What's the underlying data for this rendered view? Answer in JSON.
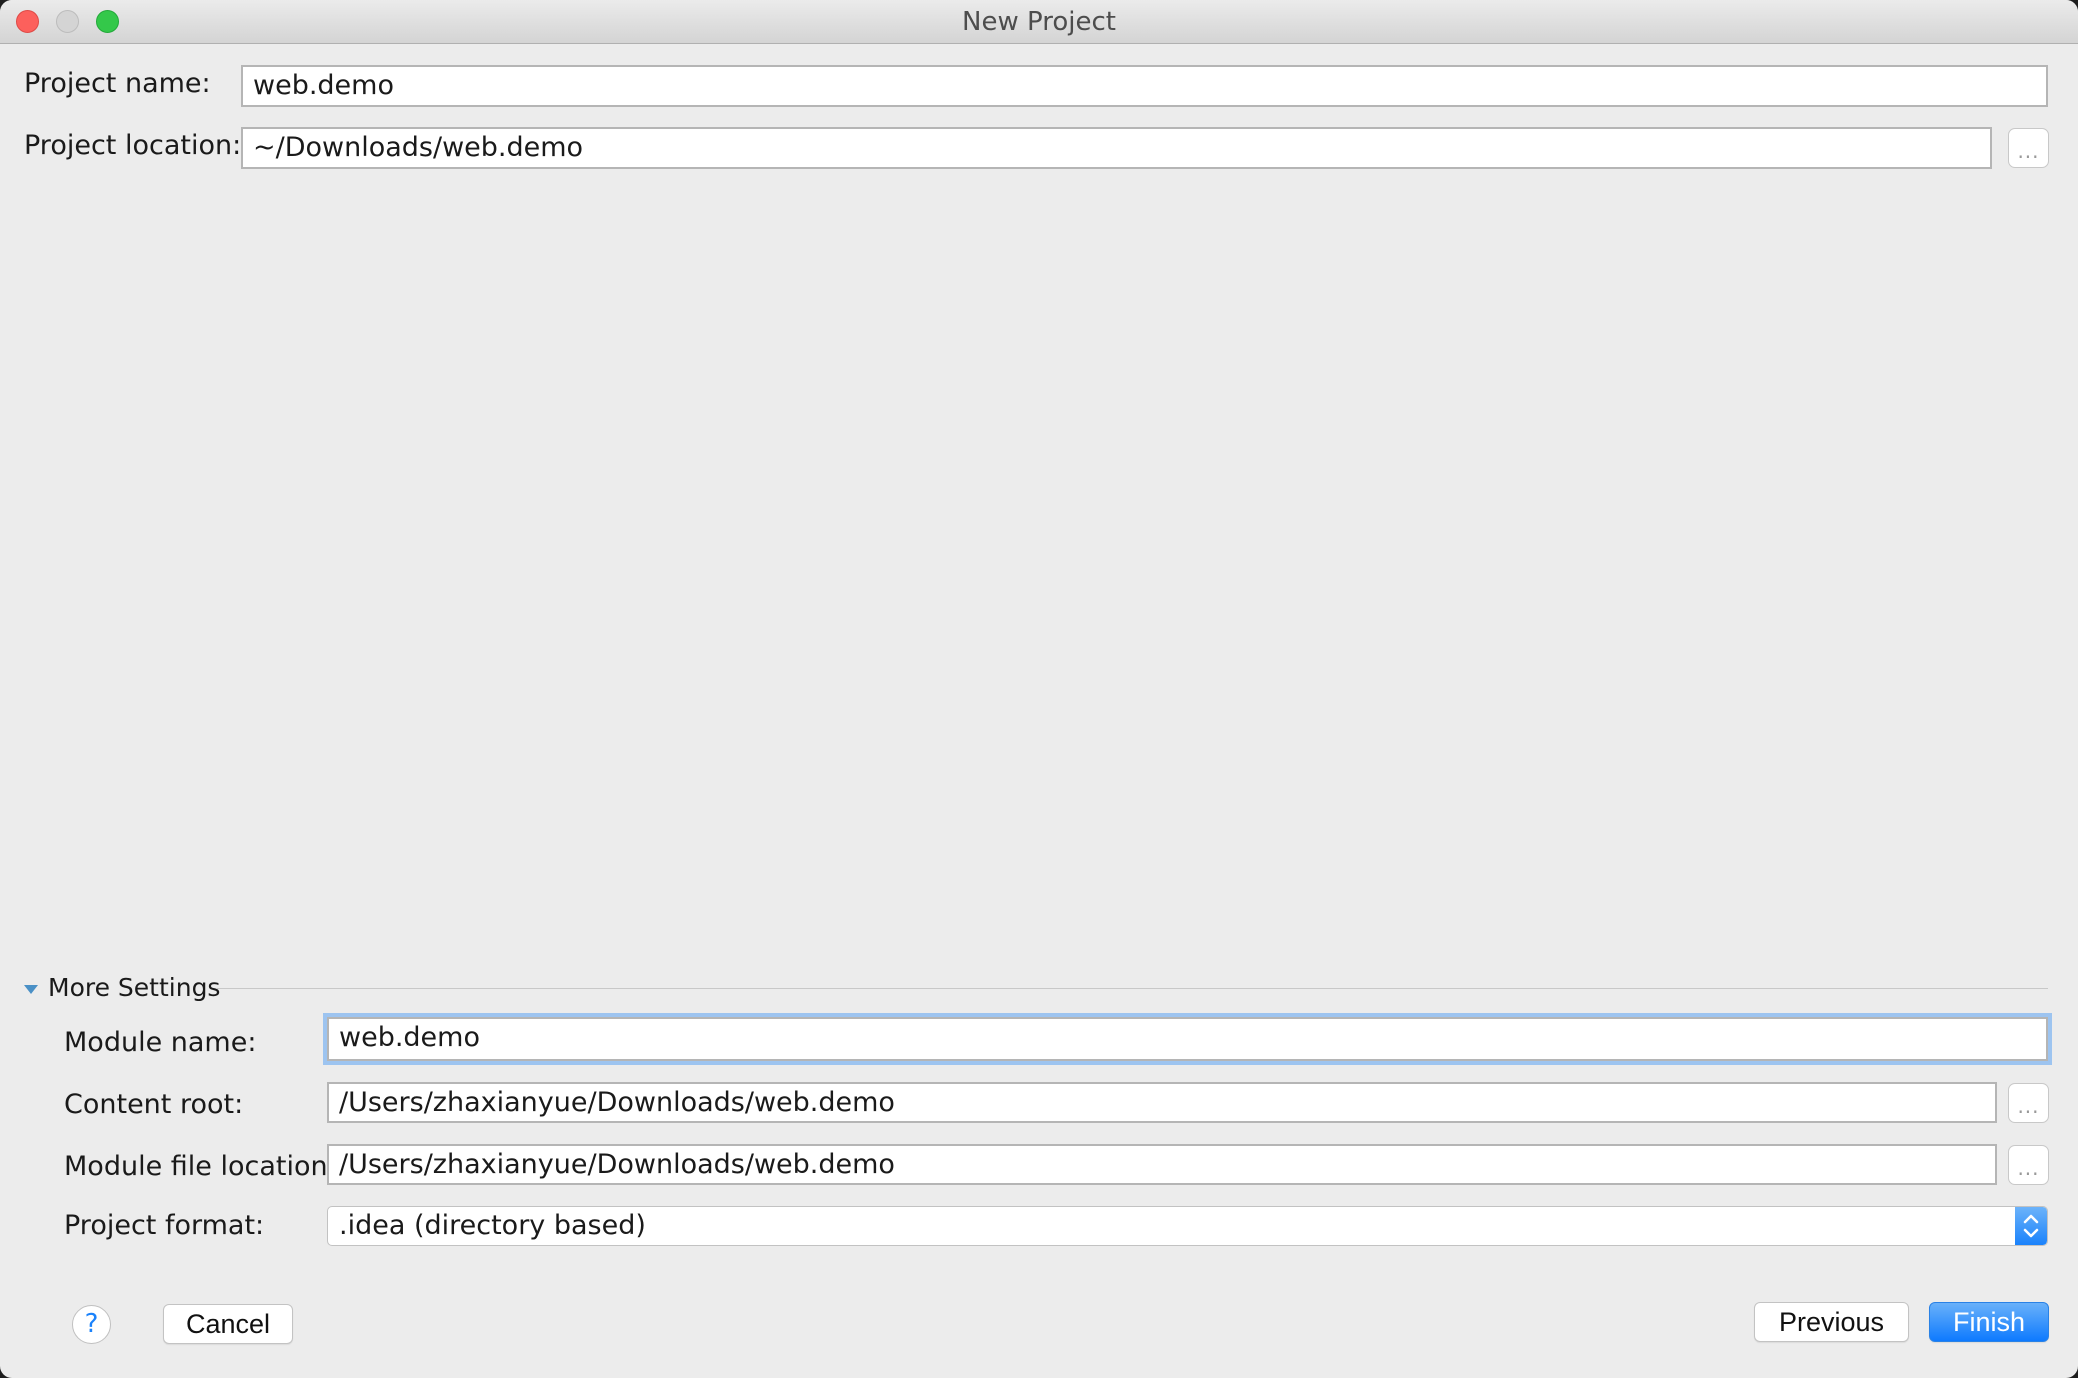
{
  "window": {
    "title": "New Project",
    "controls": [
      "close",
      "minimize",
      "maximize"
    ]
  },
  "project": {
    "name_label": "Project name:",
    "name_value": "web.demo",
    "location_label": "Project location:",
    "location_value": "~/Downloads/web.demo",
    "browse_label": "..."
  },
  "more_settings": {
    "title": "More Settings",
    "expanded": true,
    "module_name_label": "Module name:",
    "module_name_value": "web.demo",
    "content_root_label": "Content root:",
    "content_root_value": "/Users/zhaxianyue/Downloads/web.demo",
    "module_file_label": "Module file location:",
    "module_file_value": "/Users/zhaxianyue/Downloads/web.demo",
    "project_format_label": "Project format:",
    "project_format_value": ".idea (directory based)",
    "browse_label": "..."
  },
  "footer": {
    "help_label": "?",
    "cancel_label": "Cancel",
    "previous_label": "Previous",
    "finish_label": "Finish"
  },
  "colors": {
    "accent": "#1a82fb",
    "focus_ring": "#9dc4f0",
    "background": "#ececec"
  }
}
